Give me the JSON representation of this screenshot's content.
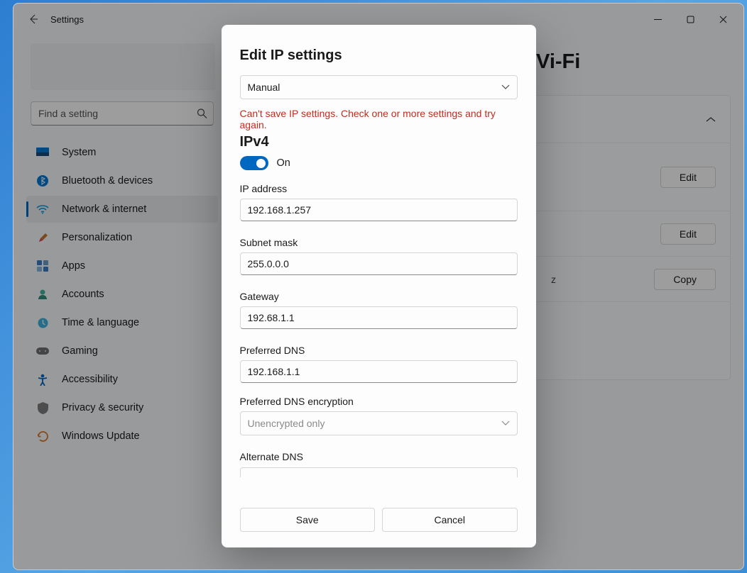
{
  "window": {
    "title": "Settings"
  },
  "search": {
    "placeholder": "Find a setting"
  },
  "nav": {
    "system": "System",
    "bluetooth": "Bluetooth & devices",
    "network": "Network & internet",
    "personalization": "Personalization",
    "apps": "Apps",
    "accounts": "Accounts",
    "time": "Time & language",
    "gaming": "Gaming",
    "accessibility": "Accessibility",
    "privacy": "Privacy & security",
    "update": "Windows Update"
  },
  "main": {
    "heading_tail": "Vi-Fi",
    "row3_tail": "z",
    "edit_label": "Edit",
    "copy_label": "Copy"
  },
  "dialog": {
    "title": "Edit IP settings",
    "mode": "Manual",
    "error": "Can't save IP settings. Check one or more settings and try again.",
    "ipv4_heading": "IPv4",
    "toggle_label": "On",
    "ip_label": "IP address",
    "ip_value": "192.168.1.257",
    "subnet_label": "Subnet mask",
    "subnet_value": "255.0.0.0",
    "gateway_label": "Gateway",
    "gateway_value": "192.68.1.1",
    "pref_dns_label": "Preferred DNS",
    "pref_dns_value": "192.168.1.1",
    "pref_dns_enc_label": "Preferred DNS encryption",
    "pref_dns_enc_value": "Unencrypted only",
    "alt_dns_label": "Alternate DNS",
    "save": "Save",
    "cancel": "Cancel"
  }
}
